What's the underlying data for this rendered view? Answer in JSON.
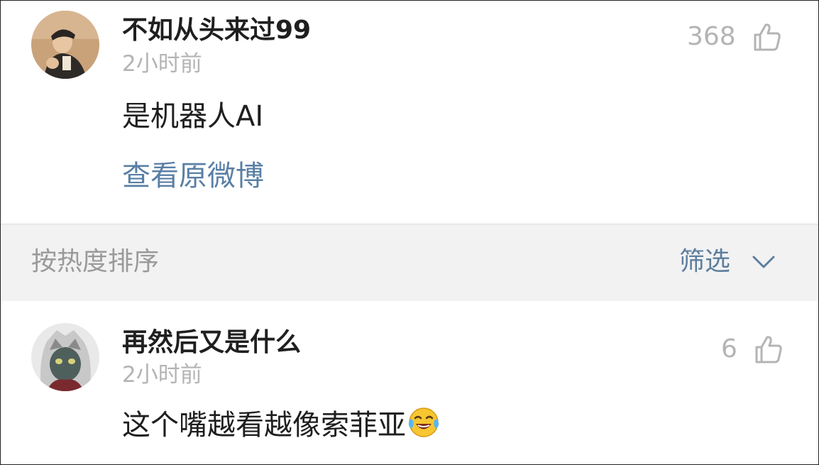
{
  "post": {
    "username": "不如从头来过99",
    "time": "2小时前",
    "likes": "368",
    "text": "是机器人AI",
    "view_original": "查看原微博",
    "avatar_icon": "user-avatar-icon",
    "like_icon": "thumbs-up-icon"
  },
  "sort_bar": {
    "label": "按热度排序",
    "filter_label": "筛选",
    "filter_icon": "chevron-down-icon"
  },
  "comment": {
    "username": "再然后又是什么",
    "time": "2小时前",
    "likes": "6",
    "text": "这个嘴越看越像索菲亚",
    "emoji": "laughing-crying-emoji",
    "avatar_icon": "cat-avatar-icon",
    "like_icon": "thumbs-up-icon"
  },
  "colors": {
    "link": "#5a7fa5",
    "muted": "#b4b4b4",
    "text": "#1f1f1f",
    "divider_bg": "#f2f2f2"
  }
}
